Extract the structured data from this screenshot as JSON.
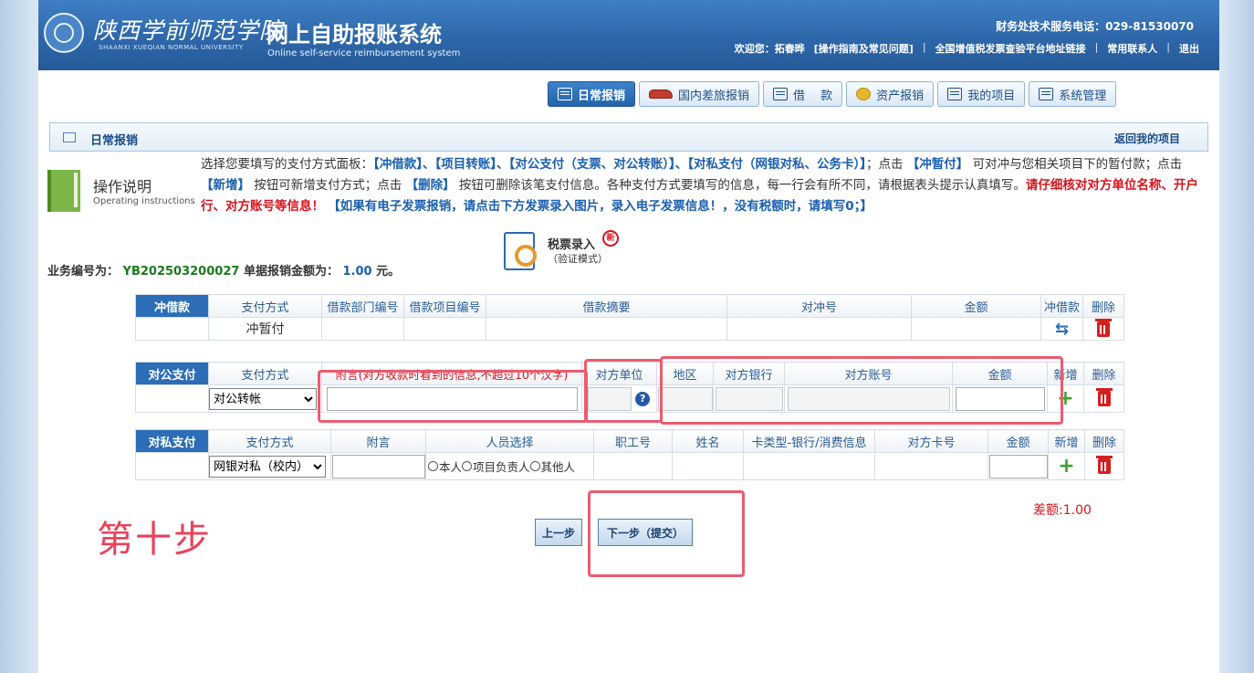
{
  "header": {
    "school_cn": "陕西学前师范学院",
    "school_en": "SHAANXI XUEQIAN NORMAL UNIVERSITY",
    "system_title": "网上自助报账系统",
    "system_en": "Online self-service reimbursement system",
    "hotline": "财务处技术服务电话：029-81530070",
    "welcome": "欢迎您：",
    "user": "拓春晔",
    "nav": [
      "[操作指南及常见问题]",
      "全国增值税发票查验平台地址链接",
      "常用联系人",
      "退出"
    ]
  },
  "modules": [
    {
      "label": "日常报销",
      "icon": "daily-icon"
    },
    {
      "label": "国内差旅报销",
      "icon": "train-icon"
    },
    {
      "label": "借　 款",
      "icon": "loan-icon"
    },
    {
      "label": "资产报销",
      "icon": "coin-icon"
    },
    {
      "label": "我的项目",
      "icon": "project-icon"
    },
    {
      "label": "系统管理",
      "icon": "settings-icon"
    }
  ],
  "section": {
    "title": "日常报销",
    "back": "返回我的项目"
  },
  "instructions": {
    "title": "操作说明",
    "subtitle": "Operating instructions",
    "p1": "选择您要填写的支付方式面板：",
    "b1": "【冲借款】、【项目转账】、【对公支付（支票、对公转账）】、【对私支付（网银对私、公务卡）】",
    "p2": "；点击",
    "b2": "【冲暂付】",
    "p3": "可对冲与您相关项目下的暂付款；点击",
    "b3": "【新增】",
    "p4": "按钮可新增支付方式；点击",
    "b4": "【删除】",
    "p5": "按钮可删除该笔支付信息。各种支付方式要填写的信息，每一行会有所不同，请根据表头提示认真填写。",
    "r1": "请仔细核对对方单位名称、开户行、对方账号等信息！",
    "b5": "【如果有电子发票报销，请点击下方发票录入图片，录入电子发票信息！，没有税额时，请填写0；】"
  },
  "business": {
    "id_label": "业务编号为：",
    "id": "YB202503200027",
    "amount_label": "单据报销金额为：",
    "amount": "1.00",
    "unit": "元。"
  },
  "tax_entry": {
    "title": "税票录入",
    "subtitle": "（验证模式）",
    "badge": "新"
  },
  "offset_table": {
    "tag": "冲借款",
    "headers": [
      "支付方式",
      "借款部门编号",
      "借款项目编号",
      "借款摘要",
      "对冲号",
      "金额",
      "冲借款",
      "删除"
    ],
    "row": {
      "method": "冲暂付"
    }
  },
  "public_table": {
    "tag": "对公支付",
    "headers": [
      "支付方式",
      "附言(对方收款时看到的信息,不超过10个汉字)",
      "对方单位",
      "地区",
      "对方银行",
      "对方账号",
      "金额",
      "新增",
      "删除"
    ],
    "row": {
      "method": "对公转帐",
      "help": "?"
    }
  },
  "private_table": {
    "tag": "对私支付",
    "headers": [
      "支付方式",
      "附言",
      "人员选择",
      "职工号",
      "姓名",
      "卡类型-银行/消费信息",
      "对方卡号",
      "金额",
      "新增",
      "删除"
    ],
    "row": {
      "method": "网银对私（校内）",
      "options": [
        "本人",
        "项目负责人",
        "其他人"
      ]
    }
  },
  "footer": {
    "step_label": "第十步",
    "diff": "差额:1.00",
    "prev": "上一步",
    "next": "下一步（提交）"
  },
  "colors": {
    "header": "#2e67aa",
    "highlight": "#ec5b6f",
    "tag": "#2b6db6"
  }
}
